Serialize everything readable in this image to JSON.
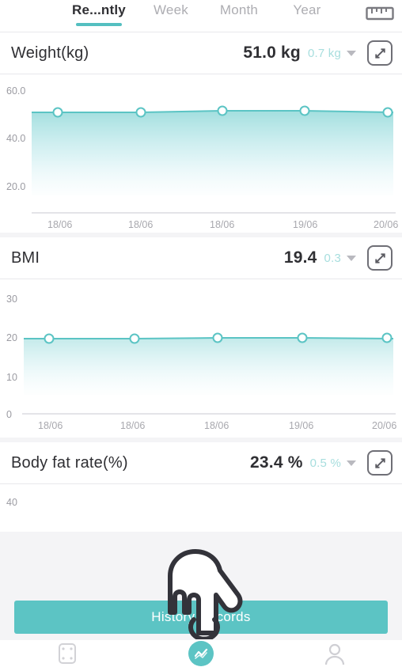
{
  "tabs": [
    {
      "label": "Re...ntly",
      "active": true
    },
    {
      "label": "Week",
      "active": false
    },
    {
      "label": "Month",
      "active": false
    },
    {
      "label": "Year",
      "active": false
    }
  ],
  "header": {
    "ruler_icon": "ruler-icon"
  },
  "sections": [
    {
      "title": "Weight(kg)",
      "value": "51.0 kg",
      "delta": "0.7 kg",
      "expand_icon": "expand-icon",
      "caret_icon": "chevron-down-icon"
    },
    {
      "title": "BMI",
      "value": "19.4",
      "delta": "0.3",
      "expand_icon": "expand-icon",
      "caret_icon": "chevron-down-icon"
    },
    {
      "title": "Body fat rate(%)",
      "value": "23.4 %",
      "delta": "0.5 %",
      "expand_icon": "expand-icon",
      "caret_icon": "chevron-down-icon"
    }
  ],
  "bottom": {
    "history_label": "History Records",
    "nav": [
      {
        "name": "scale-icon",
        "active": false
      },
      {
        "name": "trend-chart-icon",
        "active": true
      },
      {
        "name": "person-icon",
        "active": false
      }
    ]
  },
  "cursor": {
    "name": "hand-pointer-cursor"
  },
  "colors": {
    "accent": "#5cc4c4",
    "line": "#5bc4c4",
    "delta_text": "#a7dede",
    "axis_text": "#9b9ba2",
    "title_text": "#2f2f33",
    "inactive_tab": "#adadb2",
    "card_bg": "#ffffff",
    "page_bg": "#f4f4f6"
  },
  "chart_data": [
    {
      "type": "area",
      "title": "Weight(kg)",
      "xlabel": "",
      "ylabel": "",
      "categories": [
        "18/06",
        "18/06",
        "18/06",
        "19/06",
        "20/06"
      ],
      "values": [
        51.0,
        51.0,
        51.2,
        51.2,
        51.0
      ],
      "yticks": [
        "60.0",
        "40.0",
        "20.0"
      ],
      "ytick_values": [
        60.0,
        40.0,
        20.0
      ],
      "ylim": [
        12,
        64
      ],
      "grid": false,
      "legend": "none",
      "marker": "open-circle",
      "line_color": "#5bc4c4",
      "fill": "gradient teal to white"
    },
    {
      "type": "area",
      "title": "BMI",
      "xlabel": "",
      "ylabel": "",
      "categories": [
        "18/06",
        "18/06",
        "18/06",
        "19/06",
        "20/06"
      ],
      "values": [
        19.4,
        19.4,
        19.5,
        19.5,
        19.4
      ],
      "yticks": [
        "30",
        "20",
        "10",
        "0"
      ],
      "ytick_values": [
        30,
        20,
        10,
        0
      ],
      "ylim": [
        0,
        33
      ],
      "grid": false,
      "legend": "none",
      "marker": "open-circle",
      "line_color": "#5bc4c4",
      "fill": "gradient teal to white"
    },
    {
      "type": "area",
      "title": "Body fat rate(%)",
      "xlabel": "",
      "ylabel": "",
      "categories": [],
      "values": [],
      "yticks": [
        "40"
      ],
      "ytick_values": [
        40
      ],
      "ylim": [
        0,
        45
      ],
      "grid": false,
      "legend": "none",
      "note": "chart clipped by viewport bottom"
    }
  ]
}
